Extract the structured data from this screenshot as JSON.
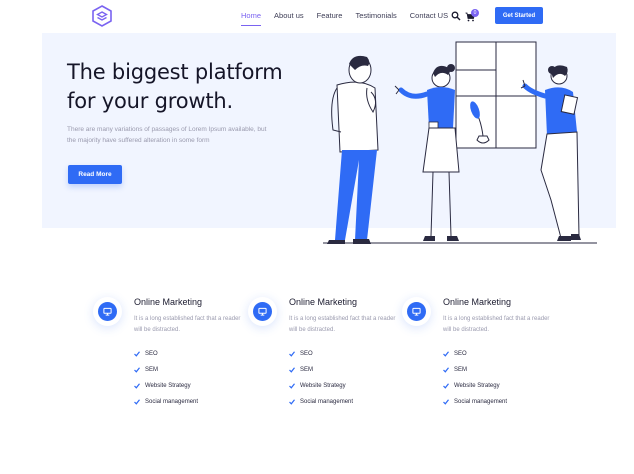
{
  "nav": {
    "links": [
      "Home",
      "About us",
      "Feature",
      "Testimonials",
      "Contact US"
    ],
    "active": "Home",
    "cart_count": "0",
    "cta_label": "Get Started"
  },
  "hero": {
    "title_line1": "The biggest platform",
    "title_line2": "for your growth.",
    "text": "There are many variations of passages of Lorem Ipsum available, but the majority have suffered alteration in some form",
    "button_label": "Read More"
  },
  "features": [
    {
      "icon": "monitor-icon",
      "title": "Online Marketing",
      "description": "It is a long established fact that a reader will be distracted.",
      "items": [
        "SEO",
        "SEM",
        "Website Strategy",
        "Social management"
      ]
    },
    {
      "icon": "monitor-icon",
      "title": "Online Marketing",
      "description": "It is a long established fact that a reader will be distracted.",
      "items": [
        "SEO",
        "SEM",
        "Website Strategy",
        "Social management"
      ]
    },
    {
      "icon": "monitor-icon",
      "title": "Online Marketing",
      "description": "It is a long established fact that a reader will be distracted.",
      "items": [
        "SEO",
        "SEM",
        "Website Strategy",
        "Social management"
      ]
    }
  ],
  "colors": {
    "accent": "#2f6bf5",
    "nav_active": "#7a63f1",
    "hero_bg": "#f1f5ff"
  }
}
